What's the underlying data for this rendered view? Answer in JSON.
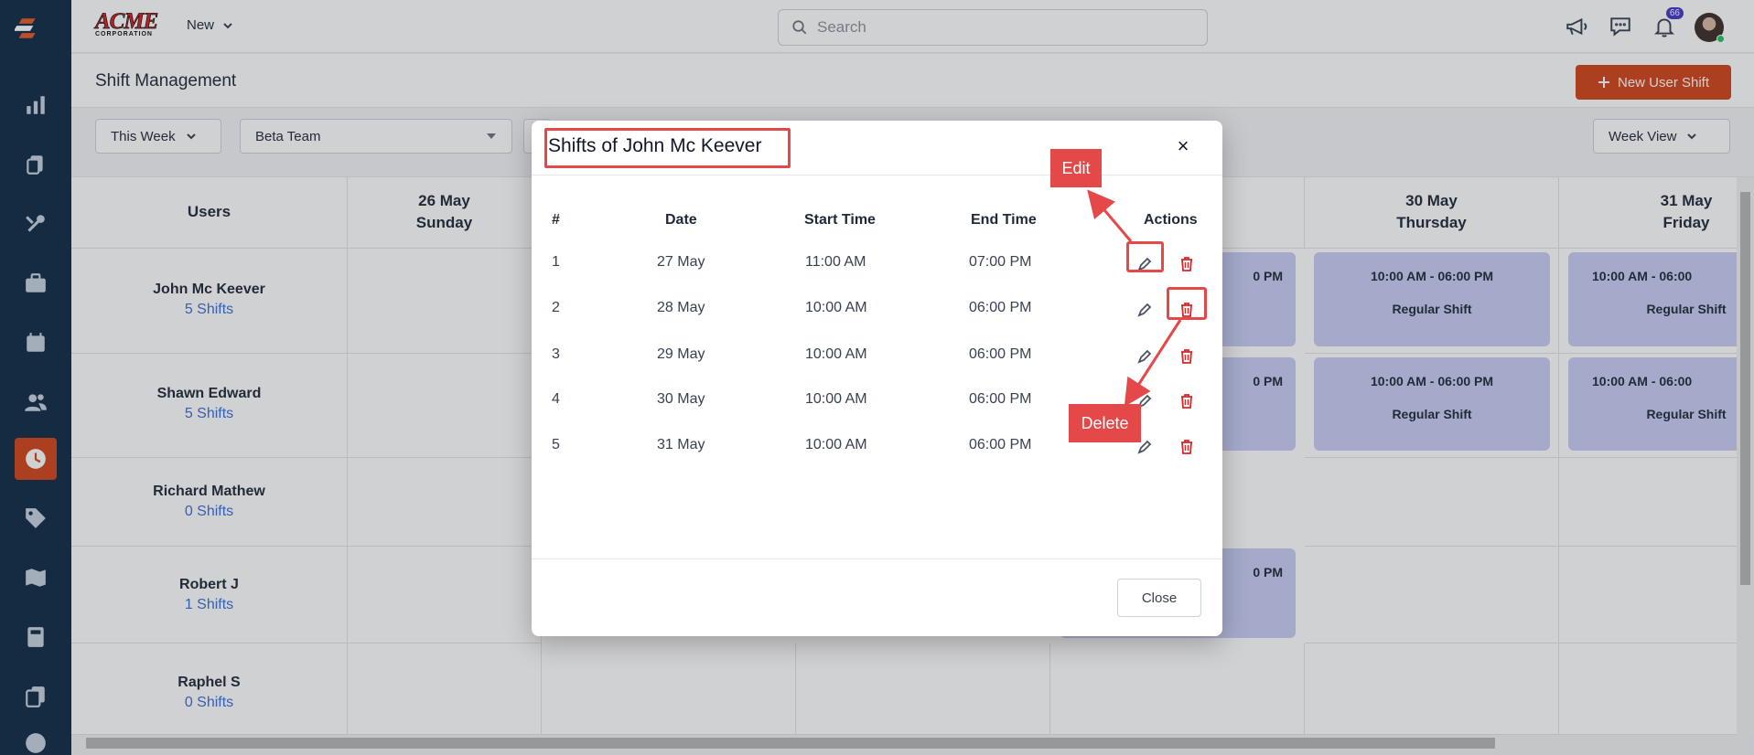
{
  "brand": {
    "name": "ACME",
    "sub": "CORPORATION"
  },
  "topbar": {
    "new_label": "New",
    "search_placeholder": "Search",
    "notification_count": "66"
  },
  "page": {
    "title": "Shift Management",
    "new_user_shift_label": "New User Shift"
  },
  "filters": {
    "period": "This Week",
    "team": "Beta Team",
    "view": "Week View"
  },
  "grid": {
    "users_header": "Users",
    "columns": [
      {
        "date": "26 May",
        "day": "Sunday"
      },
      {
        "date": "30 May",
        "day": "Thursday"
      },
      {
        "date": "31 May",
        "day": "Friday"
      }
    ],
    "users": [
      {
        "name": "John Mc Keever",
        "shifts": "5 Shifts"
      },
      {
        "name": "Shawn Edward",
        "shifts": "5 Shifts"
      },
      {
        "name": "Richard Mathew",
        "shifts": "0 Shifts"
      },
      {
        "name": "Robert J",
        "shifts": "1 Shifts"
      },
      {
        "name": "Raphel S",
        "shifts": "0 Shifts"
      }
    ],
    "card_time": "10:00 AM  -  06:00 PM",
    "card_time_cut": "10:00 AM  -  06:00",
    "card_partial": "0 PM",
    "card_type": "Regular Shift"
  },
  "modal": {
    "title": "Shifts of John Mc Keever",
    "close_x": "×",
    "headers": {
      "num": "#",
      "date": "Date",
      "start": "Start Time",
      "end": "End Time",
      "actions": "Actions"
    },
    "rows": [
      {
        "num": "1",
        "date": "27 May",
        "start": "11:00 AM",
        "end": "07:00 PM"
      },
      {
        "num": "2",
        "date": "28 May",
        "start": "10:00 AM",
        "end": "06:00 PM"
      },
      {
        "num": "3",
        "date": "29 May",
        "start": "10:00 AM",
        "end": "06:00 PM"
      },
      {
        "num": "4",
        "date": "30 May",
        "start": "10:00 AM",
        "end": "06:00 PM"
      },
      {
        "num": "5",
        "date": "31 May",
        "start": "10:00 AM",
        "end": "06:00 PM"
      }
    ],
    "close_button": "Close"
  },
  "annotations": {
    "edit": "Edit",
    "delete": "Delete",
    "color": "#e44848"
  }
}
